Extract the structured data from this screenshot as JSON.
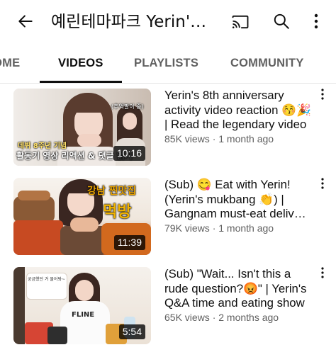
{
  "header": {
    "channel_title": "예린테마파크 Yerin's Theme Park",
    "back_icon": "arrow-left-icon",
    "cast_icon": "cast-icon",
    "search_icon": "search-icon",
    "more_icon": "more-vertical-icon"
  },
  "tabs": [
    {
      "label": "HOME",
      "selected": false
    },
    {
      "label": "VIDEOS",
      "selected": true
    },
    {
      "label": "PLAYLISTS",
      "selected": false
    },
    {
      "label": "COMMUNITY",
      "selected": false
    }
  ],
  "videos": [
    {
      "title": "Yerin's 8th anniversary activity video reaction 😚🎉 | Read the legendary video",
      "meta": "85K views · 1 month ago",
      "duration": "10:16",
      "thumb_caption": "데뷔 8주년 기념",
      "thumb_caption2": "활동기 영상 리액션 & 댓글 읽기",
      "thumb_corner": "(추억팔이 중)"
    },
    {
      "title": "(Sub) 😋 Eat with Yerin! (Yerin's mukbang 👏) | Gangnam must-eat delivery food",
      "meta": "79K views · 1 month ago",
      "duration": "11:39",
      "thumb_caption": "강남 찐맛집",
      "thumb_caption2": "먹방"
    },
    {
      "title": "(Sub) \"Wait... Isn't this a rude question?😡\" | Yerin's Q&A time and eating show",
      "meta": "65K views · 2 months ago",
      "duration": "5:54",
      "thumb_caption": "궁금했던 거 물어봐~",
      "thumb_caption2": "FLINE"
    }
  ],
  "colors": {
    "text_primary": "#0f0f0f",
    "text_secondary": "#606060",
    "tab_indicator": "#0f0f0f"
  }
}
